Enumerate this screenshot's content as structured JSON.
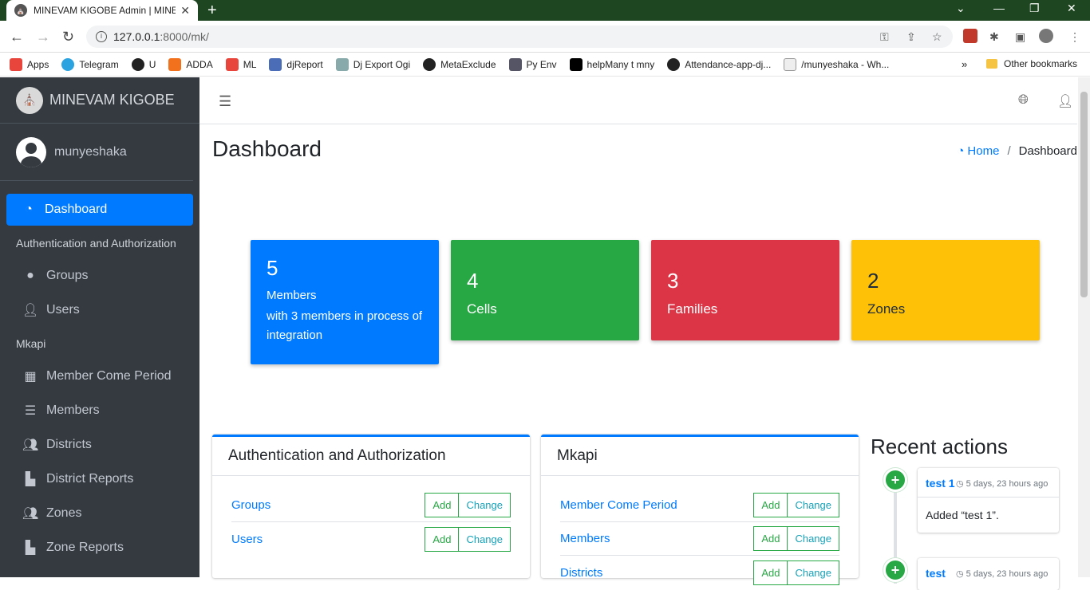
{
  "browser": {
    "tab_title": "MINEVAM KIGOBE Admin | MINE",
    "url_host": "127.0.0.1",
    "url_path": ":8000/mk/",
    "bookmarks": [
      {
        "label": "Apps",
        "color": "#e8453c"
      },
      {
        "label": "Telegram",
        "color": "#2aa3e0"
      },
      {
        "label": "U",
        "color": "#222222"
      },
      {
        "label": "ADDA",
        "color": "#f2711c"
      },
      {
        "label": "ML",
        "color": "#e8453c"
      },
      {
        "label": "djReport",
        "color": "#4b6cb7"
      },
      {
        "label": "Dj Export Ogi",
        "color": "#8aa"
      },
      {
        "label": "MetaExclude",
        "color": "#222222"
      },
      {
        "label": "Py Env",
        "color": "#556"
      },
      {
        "label": "helpMany t mny",
        "color": "#000000"
      },
      {
        "label": "Attendance-app-dj...",
        "color": "#222222"
      },
      {
        "label": "/munyeshaka - Wh...",
        "color": "#eee"
      }
    ],
    "more": "»",
    "other_bookmarks": "Other bookmarks"
  },
  "sidebar": {
    "brand": "MINEVAM KIGOBE",
    "user": "munyeshaka",
    "active": "Dashboard",
    "section_auth": "Authentication and Authorization",
    "auth_items": [
      {
        "label": "Groups",
        "icon": "circle-icon"
      },
      {
        "label": "Users",
        "icon": "user-icon"
      }
    ],
    "section_mkapi": "Mkapi",
    "mkapi_items": [
      {
        "label": "Member Come Period",
        "icon": "calendar-icon"
      },
      {
        "label": "Members",
        "icon": "list-icon"
      },
      {
        "label": "Districts",
        "icon": "users-icon"
      },
      {
        "label": "District Reports",
        "icon": "file-icon"
      },
      {
        "label": "Zones",
        "icon": "users-icon"
      },
      {
        "label": "Zone Reports",
        "icon": "file-icon"
      }
    ]
  },
  "main": {
    "title": "Dashboard",
    "breadcrumb_home": "Home",
    "breadcrumb_sep": "/",
    "breadcrumb_current": "Dashboard",
    "boxes": [
      {
        "num": "5",
        "label": "Members",
        "sub": "with 3 members in process of integration",
        "color": "#007bff"
      },
      {
        "num": "4",
        "label": "Cells",
        "color": "#28a745"
      },
      {
        "num": "3",
        "label": "Families",
        "color": "#dc3545"
      },
      {
        "num": "2",
        "label": "Zones",
        "color": "#ffc107"
      }
    ],
    "card_auth": {
      "title": "Authentication and Authorization",
      "rows": [
        "Groups",
        "Users"
      ]
    },
    "card_mkapi": {
      "title": "Mkapi",
      "rows": [
        "Member Come Period",
        "Members",
        "Districts"
      ]
    },
    "add_label": "Add",
    "change_label": "Change",
    "recent_title": "Recent actions",
    "recent": [
      {
        "name": "test 1",
        "time": "5 days, 23 hours ago",
        "body": "Added “test 1”."
      },
      {
        "name": "test",
        "time": "5 days, 23 hours ago"
      }
    ]
  }
}
